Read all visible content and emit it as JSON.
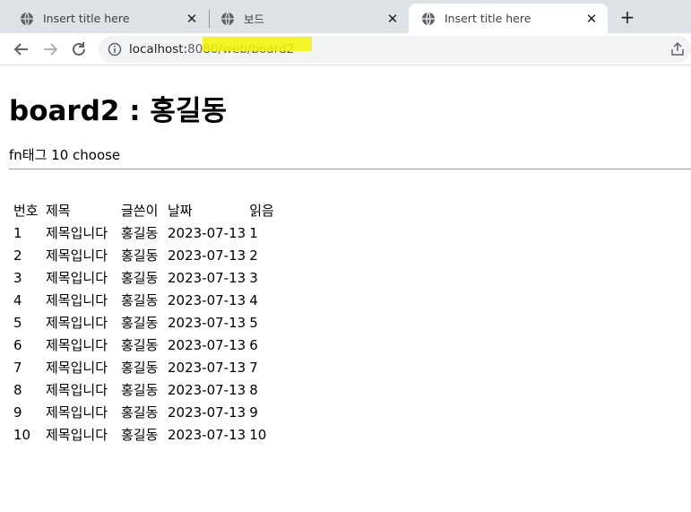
{
  "browser": {
    "tabs": [
      {
        "title": "Insert title here",
        "active": false
      },
      {
        "title": "보드",
        "active": false
      },
      {
        "title": "Insert title here",
        "active": true
      }
    ],
    "url": {
      "host": "localhost:",
      "port": "8080",
      "path": "/web/board2"
    }
  },
  "page": {
    "heading": "board2 : 홍길동",
    "subtitle": "fn태그 10 choose"
  },
  "table": {
    "headers": [
      "번호",
      "제목",
      "글쓴이",
      "날짜",
      "읽음"
    ],
    "rows": [
      [
        "1",
        "제목입니다",
        "홍길동",
        "2023-07-13",
        "1"
      ],
      [
        "2",
        "제목입니다",
        "홍길동",
        "2023-07-13",
        "2"
      ],
      [
        "3",
        "제목입니다",
        "홍길동",
        "2023-07-13",
        "3"
      ],
      [
        "4",
        "제목입니다",
        "홍길동",
        "2023-07-13",
        "4"
      ],
      [
        "5",
        "제목입니다",
        "홍길동",
        "2023-07-13",
        "5"
      ],
      [
        "6",
        "제목입니다",
        "홍길동",
        "2023-07-13",
        "6"
      ],
      [
        "7",
        "제목입니다",
        "홍길동",
        "2023-07-13",
        "7"
      ],
      [
        "8",
        "제목입니다",
        "홍길동",
        "2023-07-13",
        "8"
      ],
      [
        "9",
        "제목입니다",
        "홍길동",
        "2023-07-13",
        "9"
      ],
      [
        "10",
        "제목입니다",
        "홍길동",
        "2023-07-13",
        "10"
      ]
    ]
  },
  "colors": {
    "tabstrip": "#dee1e6",
    "highlight": "#f5f500"
  }
}
